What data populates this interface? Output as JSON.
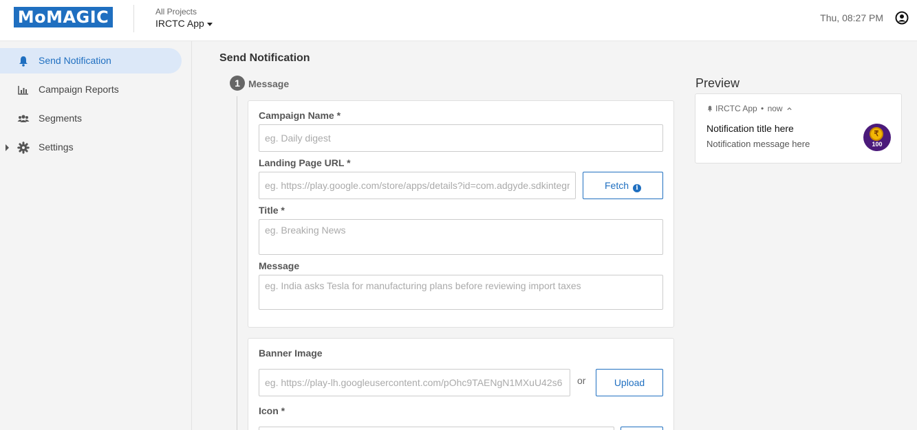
{
  "header": {
    "logo_text": "MoMAGIC",
    "project_label": "All Projects",
    "project_selected": "IRCTC App",
    "clock": "Thu, 08:27 PM"
  },
  "sidebar": {
    "items": [
      {
        "label": "Send Notification",
        "icon": "bell-icon",
        "active": true
      },
      {
        "label": "Campaign Reports",
        "icon": "bar-chart-icon",
        "active": false
      },
      {
        "label": "Segments",
        "icon": "users-icon",
        "active": false
      },
      {
        "label": "Settings",
        "icon": "gear-icon",
        "active": false
      }
    ]
  },
  "main": {
    "title": "Send Notification",
    "step": {
      "number": "1",
      "label": "Message"
    },
    "fields": {
      "campaign_name": {
        "label": "Campaign Name *",
        "placeholder": "eg. Daily digest",
        "value": ""
      },
      "landing_url": {
        "label": "Landing Page URL *",
        "placeholder": "eg. https://play.google.com/store/apps/details?id=com.adgyde.sdkintegration",
        "value": "",
        "button": "Fetch"
      },
      "title": {
        "label": "Title *",
        "placeholder": "eg. Breaking News",
        "value": ""
      },
      "message": {
        "label": "Message",
        "placeholder": "eg. India asks Tesla for manufacturing plans before reviewing import taxes",
        "value": ""
      },
      "banner_image": {
        "label": "Banner Image",
        "placeholder": "eg. https://play-lh.googleusercontent.com/pOhc9TAENgN1MXuU42s6",
        "value": "",
        "or_text": "or",
        "button": "Upload"
      },
      "icon": {
        "label": "Icon *"
      }
    }
  },
  "preview": {
    "heading": "Preview",
    "app_name": "IRCTC App",
    "separator": "•",
    "time": "now",
    "notification_title": "Notification title here",
    "notification_message": "Notification message here",
    "badge_symbol": "₹",
    "badge_number": "100"
  },
  "colors": {
    "accent": "#1f6fc0",
    "active_bg": "#dce8f8",
    "page_bg": "#f4f4f4"
  }
}
